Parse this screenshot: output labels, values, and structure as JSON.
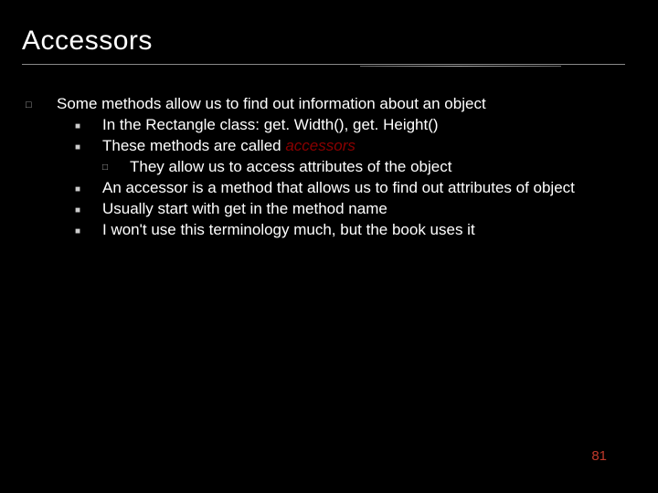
{
  "title": "Accessors",
  "intro": "Some methods allow us to find out information about an object",
  "items": [
    {
      "text": "In the Rectangle class: get. Width(), get. Height()"
    },
    {
      "text_pre": "These methods are called ",
      "accent": "accessors",
      "sub": "They allow us to access attributes of the object"
    },
    {
      "text": "An accessor is a method that allows us to find out attributes of object"
    },
    {
      "text": "Usually start with get in the method name"
    },
    {
      "text": "I won't use this terminology much, but the book uses it"
    }
  ],
  "page_number": "81"
}
